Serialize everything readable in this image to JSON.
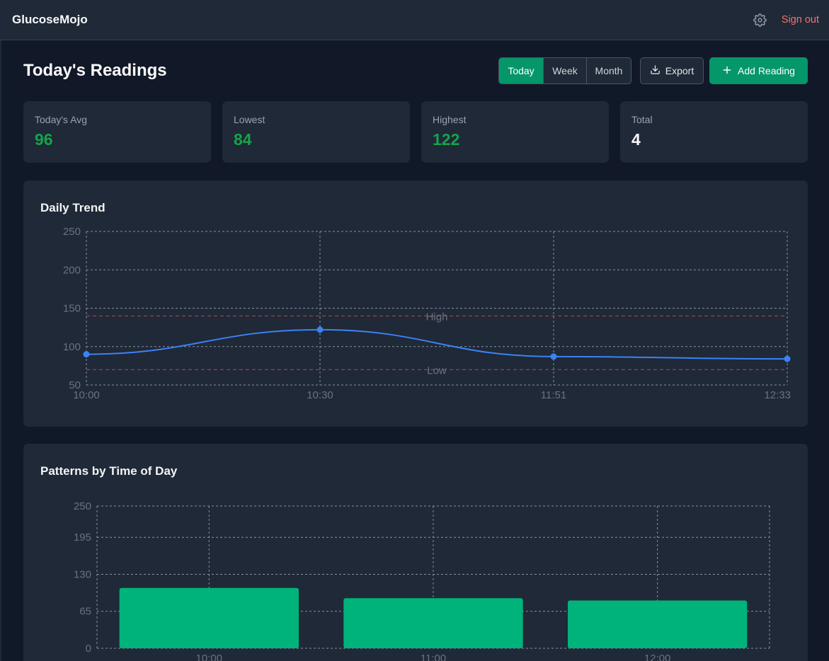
{
  "app": {
    "title": "GlucoseMojo",
    "sign_out": "Sign out"
  },
  "header": {
    "title": "Today's Readings",
    "ranges": [
      "Today",
      "Week",
      "Month"
    ],
    "active_range": "Today",
    "export_label": "Export",
    "add_label": "Add Reading"
  },
  "stats": [
    {
      "label": "Today's Avg",
      "value": "96"
    },
    {
      "label": "Lowest",
      "value": "84"
    },
    {
      "label": "Highest",
      "value": "122"
    },
    {
      "label": "Total",
      "value": "4"
    }
  ],
  "colors": {
    "accent": "#059669",
    "line": "#3b82f6",
    "bar": "#00b37a",
    "threshold": "#dc4a4a",
    "good_value": "#16a34a",
    "sign_out": "#f87171"
  },
  "chart_data": [
    {
      "type": "line",
      "title": "Daily Trend",
      "x": [
        "10:00",
        "10:30",
        "11:51",
        "12:33"
      ],
      "series": [
        {
          "values": [
            90,
            122,
            87,
            84
          ]
        }
      ],
      "ylim": [
        50,
        250
      ],
      "yticks": [
        50,
        100,
        150,
        200,
        250
      ],
      "grid": true,
      "reference_lines": [
        {
          "label": "High",
          "value": 140
        },
        {
          "label": "Low",
          "value": 70
        }
      ]
    },
    {
      "type": "bar",
      "title": "Patterns by Time of Day",
      "categories": [
        "10:00",
        "11:00",
        "12:00"
      ],
      "values": [
        106,
        88,
        84
      ],
      "ylim": [
        0,
        250
      ],
      "yticks": [
        0,
        65,
        130,
        195,
        250
      ],
      "grid": true
    }
  ]
}
